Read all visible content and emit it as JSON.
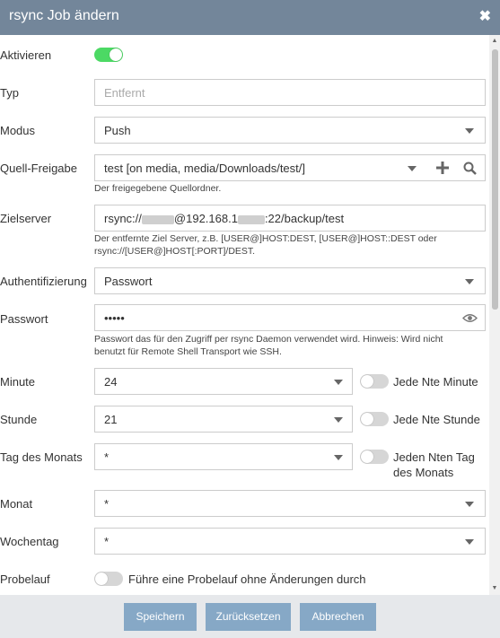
{
  "dialog": {
    "title": "rsync Job ändern",
    "close_icon": "close-icon"
  },
  "fields": {
    "aktivieren": {
      "label": "Aktivieren",
      "enabled": true
    },
    "typ": {
      "label": "Typ",
      "placeholder": "Entfernt"
    },
    "modus": {
      "label": "Modus",
      "value": "Push"
    },
    "quelle": {
      "label": "Quell-Freigabe",
      "value": "test [on media, media/Downloads/test/]",
      "help": "Der freigegebene Quellordner."
    },
    "ziel": {
      "label": "Zielserver",
      "value_prefix": "rsync://",
      "value_mid": "@192.168.1",
      "value_suffix": ":22/backup/test",
      "help_line1": "Der entfernte Ziel Server, z.B. [USER@]HOST:DEST, [USER@]HOST::DEST oder",
      "help_line2": "rsync://[USER@]HOST[:PORT]/DEST."
    },
    "auth": {
      "label": "Authentifizierung",
      "value": "Passwort"
    },
    "passwort": {
      "label": "Passwort",
      "value": "•••••",
      "help_line1": "Passwort das für den Zugriff per rsync Daemon verwendet wird. Hinweis: Wird nicht",
      "help_line2": "benutzt für Remote Shell Transport wie SSH."
    },
    "minute": {
      "label": "Minute",
      "value": "24",
      "toggle_label": "Jede Nte Minute"
    },
    "stunde": {
      "label": "Stunde",
      "value": "21",
      "toggle_label": "Jede Nte Stunde"
    },
    "tag": {
      "label": "Tag des Monats",
      "value": "*",
      "toggle_label_1": "Jeden Nten Tag",
      "toggle_label_2": "des Monats"
    },
    "monat": {
      "label": "Monat",
      "value": "*"
    },
    "wochentag": {
      "label": "Wochentag",
      "value": "*"
    },
    "probelauf": {
      "label": "Probelauf",
      "toggle_label": "Führe eine Probelauf ohne Änderungen durch",
      "enabled": false
    }
  },
  "footer": {
    "save": "Speichern",
    "reset": "Zurücksetzen",
    "cancel": "Abbrechen"
  },
  "colors": {
    "header": "#73869a",
    "button": "#86a8c6",
    "toggle_on": "#4cd964"
  }
}
